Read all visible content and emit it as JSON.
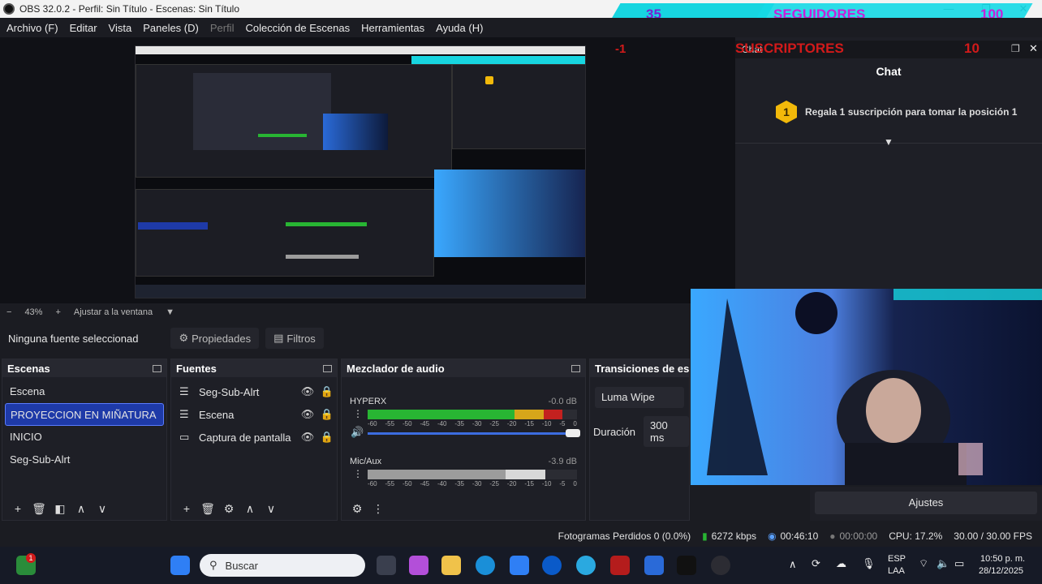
{
  "window": {
    "title": "OBS 32.0.2 - Perfil: Sin Título - Escenas: Sin Título",
    "minimize": "—",
    "maximize": "❐",
    "close": "✕"
  },
  "overlay": {
    "followers_count": "35",
    "followers_label": "SEGUIDORES",
    "followers_goal": "100",
    "subs_count": "-1",
    "subs_label": "SUSCRIPTORES",
    "subs_goal": "10"
  },
  "menu": {
    "archivo": "Archivo (F)",
    "editar": "Editar",
    "vista": "Vista",
    "paneles": "Paneles (D)",
    "perfil": "Perfil",
    "coleccion": "Colección de Escenas",
    "herramientas": "Herramientas",
    "ayuda": "Ayuda (H)"
  },
  "chat": {
    "dock_title": "Chat",
    "title": "Chat",
    "badge": "1",
    "message": "Regala 1 suscripción para tomar la posición 1"
  },
  "zoom": {
    "minus": "−",
    "level": "43%",
    "plus": "+",
    "fit": "Ajustar a la ventana"
  },
  "source_bar": {
    "no_source": "Ninguna fuente seleccionad",
    "properties": "Propiedades",
    "filters": "Filtros"
  },
  "scenes": {
    "title": "Escenas",
    "items": [
      "Escena",
      "PROYECCION EN MIÑATURA",
      "INICIO",
      "Seg-Sub-Alrt"
    ]
  },
  "sources": {
    "title": "Fuentes",
    "items": [
      "Seg-Sub-Alrt",
      "Escena",
      "Captura de pantalla"
    ]
  },
  "mixer": {
    "title": "Mezclador de audio",
    "channels": [
      {
        "name": "HYPERX",
        "db": "-0.0 dB",
        "level": 0.93
      },
      {
        "name": "Mic/Aux",
        "db": "-3.9 dB",
        "level": 0.85
      }
    ],
    "scale": [
      "-60",
      "-55",
      "-50",
      "-45",
      "-40",
      "-35",
      "-30",
      "-25",
      "-20",
      "-15",
      "-10",
      "-5",
      "0"
    ]
  },
  "transitions": {
    "title": "Transiciones de esc",
    "selected": "Luma Wipe",
    "duration_label": "Duración",
    "duration_value": "300 ms"
  },
  "controls": {
    "settings": "Ajustes"
  },
  "status": {
    "dropped": "Fotogramas Perdidos 0 (0.0%)",
    "bitrate": "6272 kbps",
    "live_time": "00:46:10",
    "rec_time": "00:00:00",
    "cpu": "CPU: 17.2%",
    "fps": "30.00 / 30.00 FPS"
  },
  "taskbar": {
    "search_placeholder": "Buscar",
    "notification_count": "1",
    "lang_top": "ESP",
    "lang_bottom": "LAA",
    "time": "10:50 p. m.",
    "date": "28/12/2025"
  },
  "colors": {
    "accent_blue": "#1e3aa8",
    "overlay_cyan": "#17d5e0",
    "overlay_magenta": "#c81fd8",
    "overlay_red": "#d21a1a"
  }
}
